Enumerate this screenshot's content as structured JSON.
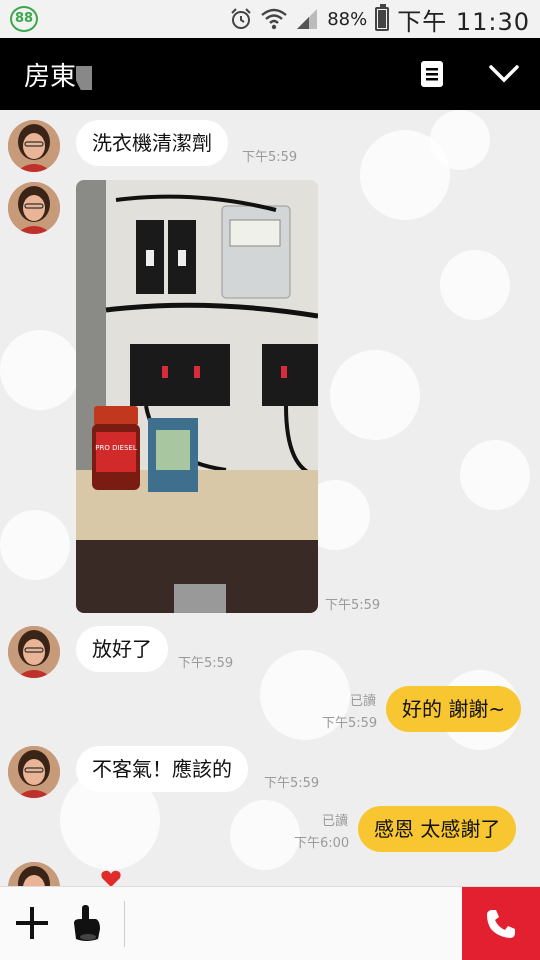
{
  "status_bar": {
    "badge": "88",
    "battery": "88%",
    "battery_level": 0.88,
    "time": "下午 11:30",
    "icons": [
      "alarm-icon",
      "wifi-icon",
      "signal-icon",
      "battery-icon"
    ]
  },
  "header": {
    "title": "房東",
    "icons": [
      "note-icon",
      "chevron-down-icon"
    ]
  },
  "messages": [
    {
      "sender": "other",
      "type": "text",
      "text": "洗衣機清潔劑",
      "time": "下午5:59"
    },
    {
      "sender": "other",
      "type": "image",
      "time": "下午5:59",
      "image_label": "PRO DIESEL"
    },
    {
      "sender": "other",
      "type": "text",
      "text": "放好了",
      "time": "下午5:59"
    },
    {
      "sender": "me",
      "type": "text",
      "text": "好的 謝謝~",
      "time": "下午5:59",
      "read": "已讀"
    },
    {
      "sender": "other",
      "type": "text",
      "text": "不客氣！應該的",
      "time": "下午5:59"
    },
    {
      "sender": "me",
      "type": "text",
      "text": "感恩 太感謝了",
      "time": "下午6:00",
      "read": "已讀"
    }
  ],
  "bottom_bar": {
    "icons": [
      "plus-icon",
      "sticker-icon",
      "phone-icon"
    ]
  },
  "colors": {
    "header_bg": "#000000",
    "my_bubble": "#f7c631",
    "call_button": "#e3202f",
    "badge": "#3aa84b"
  }
}
